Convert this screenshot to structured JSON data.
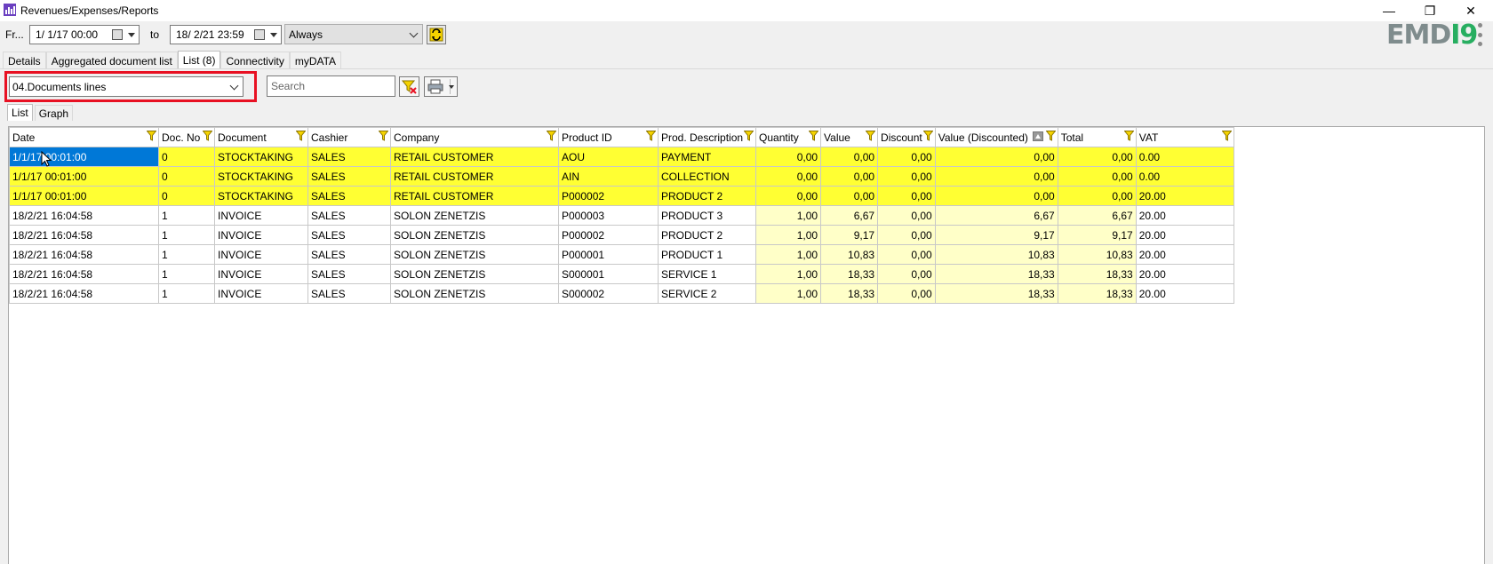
{
  "window": {
    "title": "Revenues/Expenses/Reports",
    "controls": {
      "minimize": "—",
      "restore": "❐",
      "close": "✕"
    }
  },
  "toolbar": {
    "from_label": "Fr...",
    "from_date": "1/  1/17 00:00",
    "to_label": "to",
    "to_date": "18/  2/21 23:59",
    "period": "Always"
  },
  "logo": {
    "part1": "EMD",
    "part2": "I9"
  },
  "tabs": [
    {
      "label": "Details"
    },
    {
      "label": "Aggregated document list"
    },
    {
      "label": "List (8)"
    },
    {
      "label": "Connectivity"
    },
    {
      "label": "myDATA"
    }
  ],
  "report": {
    "selected": "04.Documents lines"
  },
  "search": {
    "placeholder": "Search"
  },
  "subtabs": [
    {
      "label": "List"
    },
    {
      "label": "Graph"
    }
  ],
  "grid": {
    "columns": [
      "Date",
      "Doc. No",
      "Document",
      "Cashier",
      "Company",
      "Product ID",
      "Prod. Description",
      "Quantity",
      "Value",
      "Discount",
      "Value (Discounted)",
      "Total",
      "VAT"
    ],
    "rows": [
      [
        "1/1/17 00:01:00",
        "0",
        "STOCKTAKING",
        "SALES",
        "RETAIL CUSTOMER",
        "AOU",
        "PAYMENT",
        "0,00",
        "0,00",
        "0,00",
        "0,00",
        "0,00",
        "0.00"
      ],
      [
        "1/1/17 00:01:00",
        "0",
        "STOCKTAKING",
        "SALES",
        "RETAIL CUSTOMER",
        "AIN",
        "COLLECTION",
        "0,00",
        "0,00",
        "0,00",
        "0,00",
        "0,00",
        "0.00"
      ],
      [
        "1/1/17 00:01:00",
        "0",
        "STOCKTAKING",
        "SALES",
        "RETAIL CUSTOMER",
        "P000002",
        "PRODUCT 2",
        "0,00",
        "0,00",
        "0,00",
        "0,00",
        "0,00",
        "20.00"
      ],
      [
        "18/2/21 16:04:58",
        "1",
        "INVOICE",
        "SALES",
        "SOLON ZENETZIS",
        "P000003",
        "PRODUCT 3",
        "1,00",
        "6,67",
        "0,00",
        "6,67",
        "6,67",
        "20.00"
      ],
      [
        "18/2/21 16:04:58",
        "1",
        "INVOICE",
        "SALES",
        "SOLON ZENETZIS",
        "P000002",
        "PRODUCT 2",
        "1,00",
        "9,17",
        "0,00",
        "9,17",
        "9,17",
        "20.00"
      ],
      [
        "18/2/21 16:04:58",
        "1",
        "INVOICE",
        "SALES",
        "SOLON ZENETZIS",
        "P000001",
        "PRODUCT 1",
        "1,00",
        "10,83",
        "0,00",
        "10,83",
        "10,83",
        "20.00"
      ],
      [
        "18/2/21 16:04:58",
        "1",
        "INVOICE",
        "SALES",
        "SOLON ZENETZIS",
        "S000001",
        "SERVICE 1",
        "1,00",
        "18,33",
        "0,00",
        "18,33",
        "18,33",
        "20.00"
      ],
      [
        "18/2/21 16:04:58",
        "1",
        "INVOICE",
        "SALES",
        "SOLON ZENETZIS",
        "S000002",
        "SERVICE 2",
        "1,00",
        "18,33",
        "0,00",
        "18,33",
        "18,33",
        "20.00"
      ]
    ],
    "row_styles": [
      "yellow",
      "yellow",
      "yellow",
      "white",
      "white",
      "white",
      "white",
      "white"
    ]
  },
  "colors": {
    "highlight_row": "#ffff33",
    "numeric_cell": "#ffffc8",
    "selection": "#0078d7",
    "annotation_box": "#e81123"
  }
}
